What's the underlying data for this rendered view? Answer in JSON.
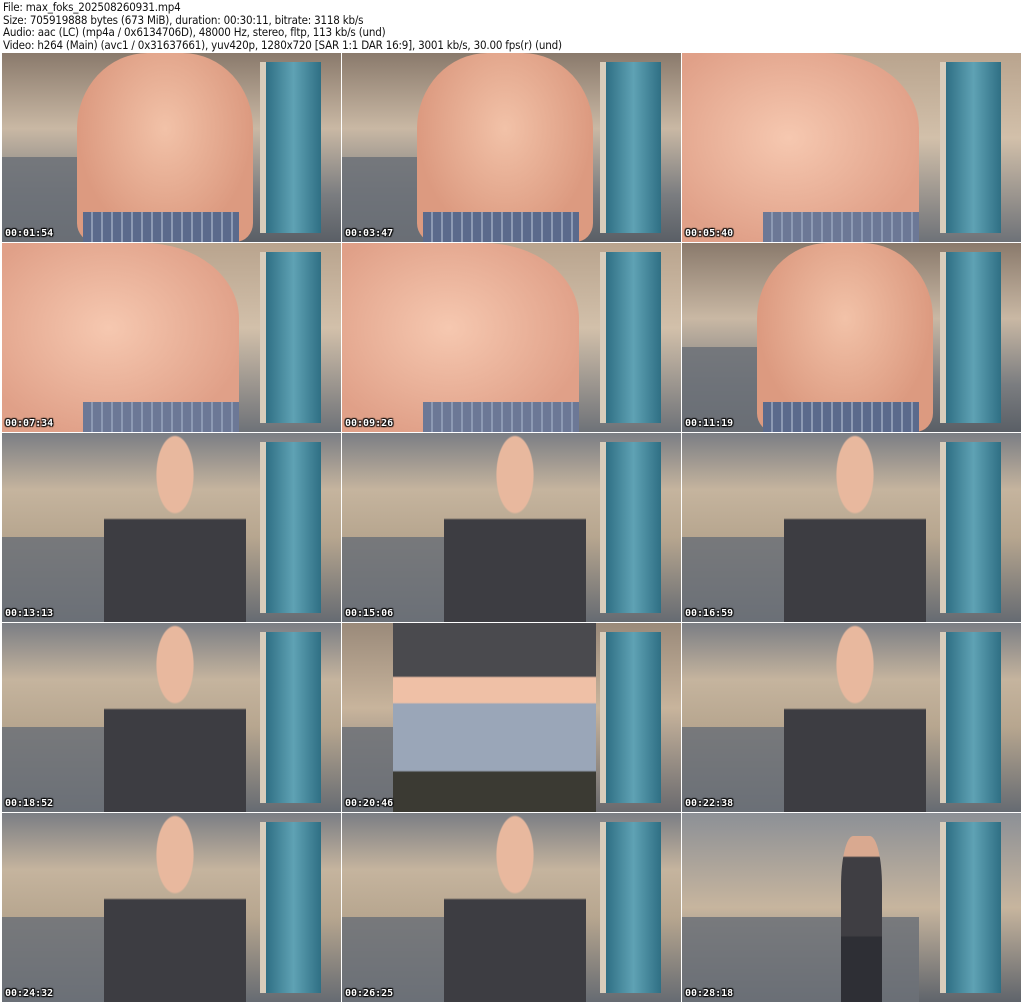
{
  "header": {
    "file": "File: max_foks_202508260931.mp4",
    "size": "Size: 705919888 bytes (673 MiB), duration: 00:30:11, bitrate: 3118 kb/s",
    "audio": "Audio: aac (LC) (mp4a / 0x6134706D), 48000 Hz, stereo, fltp, 113 kb/s (und)",
    "video": "Video: h264 (Main) (avc1 / 0x31637661), yuv420p, 1280x720 [SAR 1:1 DAR 16:9], 3001 kb/s, 30.00 fps(r) (und)"
  },
  "thumbnails": [
    {
      "time": "00:01:54",
      "scene": "torso"
    },
    {
      "time": "00:03:47",
      "scene": "torso"
    },
    {
      "time": "00:05:40",
      "scene": "torso-close"
    },
    {
      "time": "00:07:34",
      "scene": "torso-close"
    },
    {
      "time": "00:09:26",
      "scene": "torso-close"
    },
    {
      "time": "00:11:19",
      "scene": "torso"
    },
    {
      "time": "00:13:13",
      "scene": "seated"
    },
    {
      "time": "00:15:06",
      "scene": "seated"
    },
    {
      "time": "00:16:59",
      "scene": "seated"
    },
    {
      "time": "00:18:52",
      "scene": "seated"
    },
    {
      "time": "00:20:46",
      "scene": "standing-close"
    },
    {
      "time": "00:22:38",
      "scene": "seated"
    },
    {
      "time": "00:24:32",
      "scene": "seated"
    },
    {
      "time": "00:26:25",
      "scene": "seated"
    },
    {
      "time": "00:28:18",
      "scene": "standing-far"
    }
  ]
}
